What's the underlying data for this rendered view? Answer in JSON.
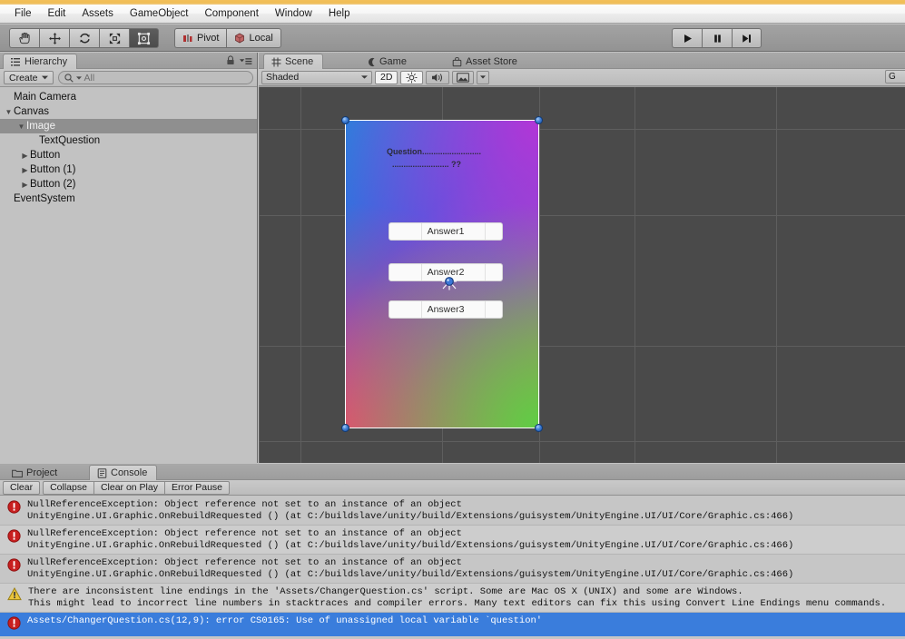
{
  "menubar": {
    "items": [
      "File",
      "Edit",
      "Assets",
      "GameObject",
      "Component",
      "Window",
      "Help"
    ]
  },
  "toolbar": {
    "tools": [
      {
        "name": "hand-tool",
        "label": "Hand",
        "active": false
      },
      {
        "name": "move-tool",
        "label": "Move",
        "active": false
      },
      {
        "name": "rotate-tool",
        "label": "Rotate",
        "active": false
      },
      {
        "name": "scale-tool",
        "label": "Scale",
        "active": false
      },
      {
        "name": "rect-tool",
        "label": "Rect",
        "active": true
      }
    ],
    "pivot_label": "Pivot",
    "local_label": "Local",
    "play_label": "Play",
    "pause_label": "Pause",
    "step_label": "Step"
  },
  "hierarchy": {
    "tab_label": "Hierarchy",
    "create_label": "Create",
    "search_placeholder": "All",
    "search_value": "",
    "items": [
      {
        "label": "Main Camera",
        "depth": 0,
        "arrow": "",
        "selected": false
      },
      {
        "label": "Canvas",
        "depth": 0,
        "arrow": "▼",
        "selected": false
      },
      {
        "label": "Image",
        "depth": 1,
        "arrow": "▼",
        "selected": true
      },
      {
        "label": "TextQuestion",
        "depth": 2,
        "arrow": "",
        "selected": false
      },
      {
        "label": "Button",
        "depth": 2,
        "arrow": "▶",
        "selected": false
      },
      {
        "label": "Button (1)",
        "depth": 2,
        "arrow": "▶",
        "selected": false
      },
      {
        "label": "Button (2)",
        "depth": 2,
        "arrow": "▶",
        "selected": false
      },
      {
        "label": "EventSystem",
        "depth": 0,
        "arrow": "",
        "selected": false
      }
    ]
  },
  "scene": {
    "tabs": [
      {
        "label": "Scene",
        "selected": true,
        "icon": "grid-icon"
      },
      {
        "label": "Game",
        "selected": false,
        "icon": "gamepad-icon"
      },
      {
        "label": "Asset Store",
        "selected": false,
        "icon": "store-icon"
      }
    ],
    "shading_mode": "Shaded",
    "mode_2d": "2D",
    "lighting_label": "Lighting",
    "audio_label": "Audio",
    "effects_label": "Effects",
    "gizmos_label": "G",
    "canvas": {
      "question_line1": "Question..........................",
      "question_line2": "......................... ??",
      "answers": [
        "Answer1",
        "Answer2",
        "Answer3"
      ]
    }
  },
  "console": {
    "tabs": [
      {
        "label": "Project",
        "selected": false,
        "icon": "folder-icon"
      },
      {
        "label": "Console",
        "selected": true,
        "icon": "console-icon"
      }
    ],
    "buttons": [
      "Clear",
      "Collapse",
      "Clear on Play",
      "Error Pause"
    ],
    "logs": [
      {
        "type": "error",
        "line1": "NullReferenceException: Object reference not set to an instance of an object",
        "line2": "UnityEngine.UI.Graphic.OnRebuildRequested () (at C:/buildslave/unity/build/Extensions/guisystem/UnityEngine.UI/UI/Core/Graphic.cs:466)",
        "selected": false,
        "stripe": "base"
      },
      {
        "type": "error",
        "line1": "NullReferenceException: Object reference not set to an instance of an object",
        "line2": "UnityEngine.UI.Graphic.OnRebuildRequested () (at C:/buildslave/unity/build/Extensions/guisystem/UnityEngine.UI/UI/Core/Graphic.cs:466)",
        "selected": false,
        "stripe": "alt"
      },
      {
        "type": "error",
        "line1": "NullReferenceException: Object reference not set to an instance of an object",
        "line2": "UnityEngine.UI.Graphic.OnRebuildRequested () (at C:/buildslave/unity/build/Extensions/guisystem/UnityEngine.UI/UI/Core/Graphic.cs:466)",
        "selected": false,
        "stripe": "base"
      },
      {
        "type": "warning",
        "line1": "There are inconsistent line endings in the 'Assets/ChangerQuestion.cs' script. Some are Mac OS X (UNIX) and some are Windows.",
        "line2": "This might lead to incorrect line numbers in stacktraces and compiler errors. Many text editors can fix this using Convert Line Endings menu commands.",
        "selected": false,
        "stripe": "alt"
      },
      {
        "type": "error",
        "line1": "Assets/ChangerQuestion.cs(12,9): error CS0165: Use of unassigned local variable `question'",
        "line2": "",
        "selected": true,
        "stripe": "selected"
      }
    ]
  },
  "colors": {
    "selection_blue": "#3a7ddc",
    "error_red": "#cc2222",
    "warning_yellow": "#e8c13a",
    "gold_strip": "#f0bd55",
    "viewport_bg": "#4a4a4a"
  }
}
